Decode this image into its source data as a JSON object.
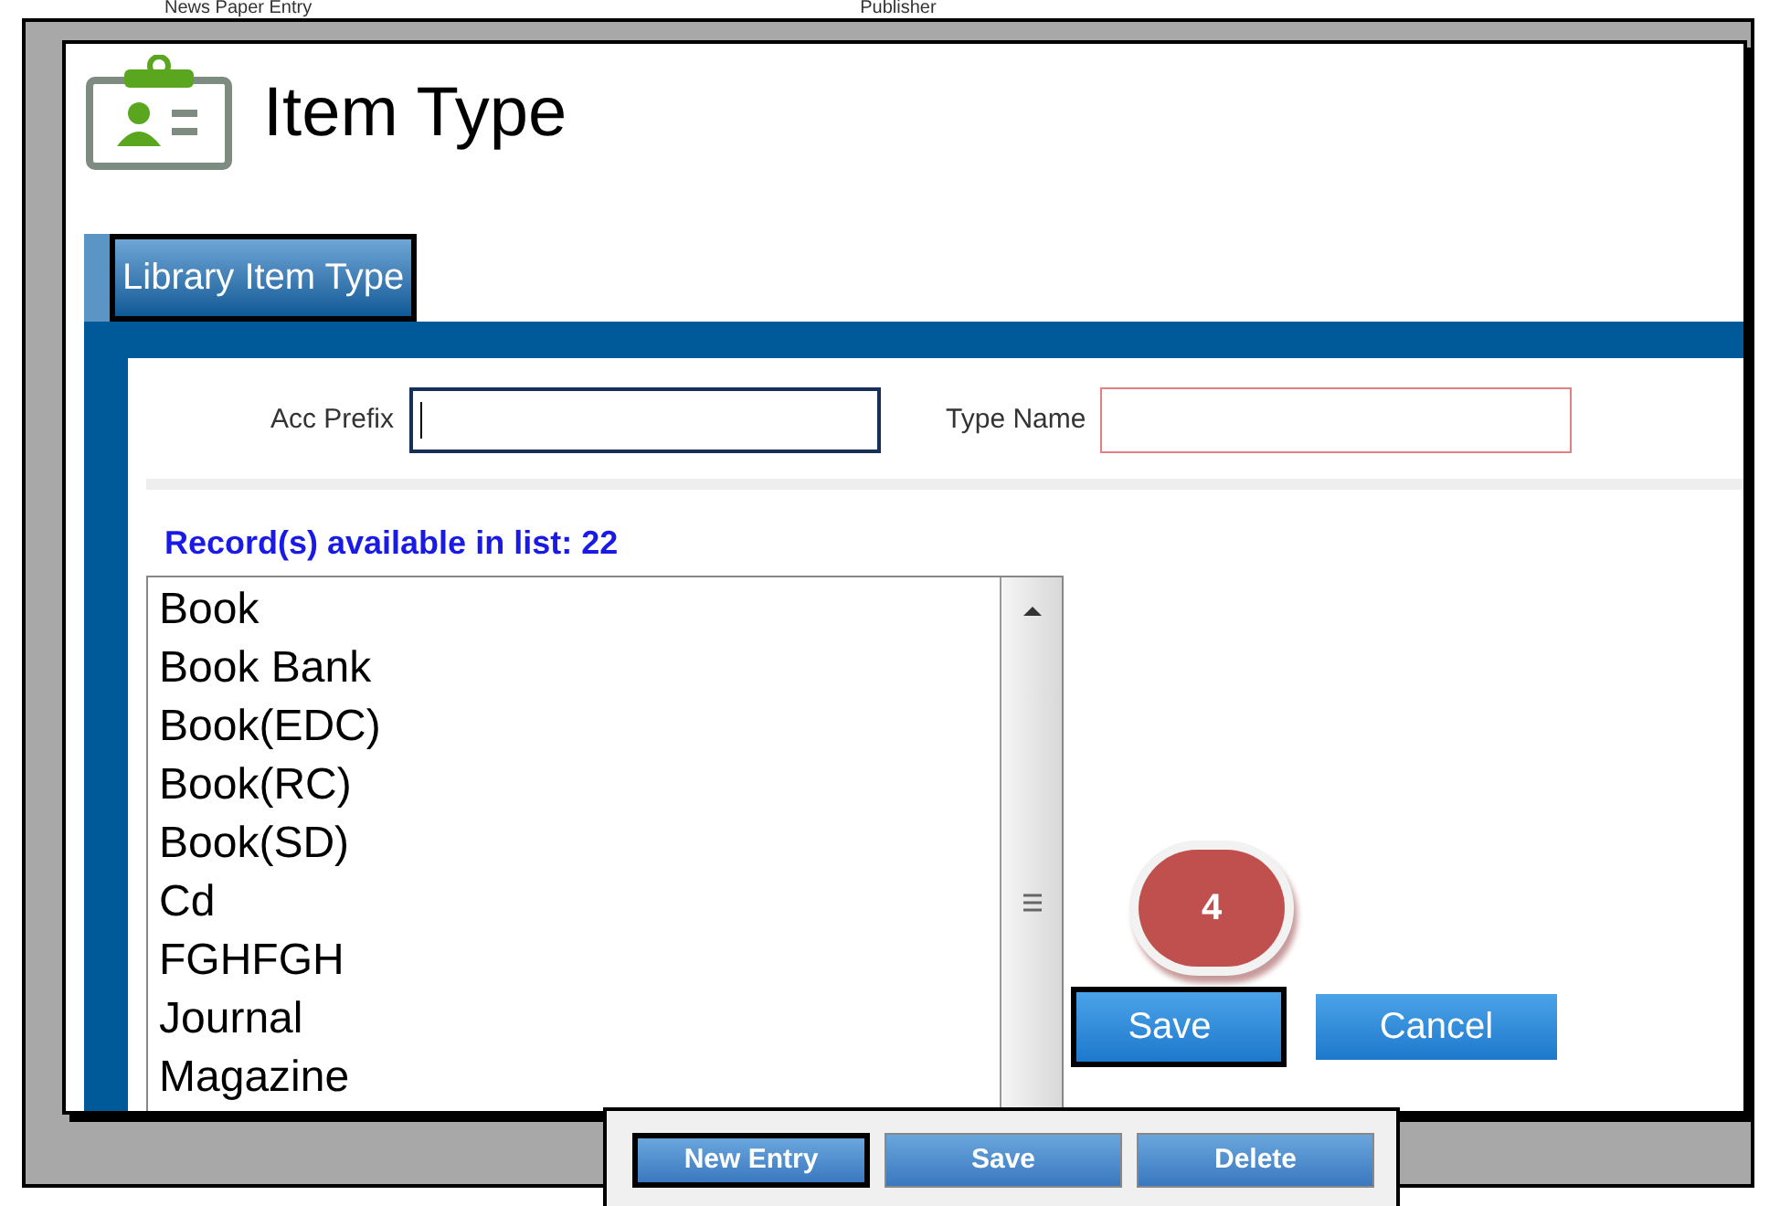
{
  "background": {
    "texts": [
      "News Paper Entry",
      "Publisher"
    ]
  },
  "window": {
    "title": "Item Type"
  },
  "tabs": [
    {
      "label": "Library Item Type",
      "selected": true
    }
  ],
  "form": {
    "fields": [
      {
        "label": "Acc Prefix",
        "focused": true,
        "invalid": false
      },
      {
        "label": "Type Name",
        "focused": false,
        "invalid": true
      }
    ]
  },
  "records": {
    "caption": "Record(s) available in list: 22",
    "items": [
      "Book",
      "Book Bank",
      "Book(EDC)",
      "Book(RC)",
      "Book(SD)",
      "Cd",
      "FGHFGH",
      "Journal",
      "Magazine"
    ]
  },
  "step_badge": "4",
  "buttons": [
    {
      "label": "Save",
      "highlighted": true
    },
    {
      "label": "Cancel",
      "highlighted": false
    }
  ],
  "toolbar": [
    {
      "label": "New Entry",
      "highlighted": true
    },
    {
      "label": "Save",
      "highlighted": false
    },
    {
      "label": "Delete",
      "highlighted": false
    }
  ]
}
